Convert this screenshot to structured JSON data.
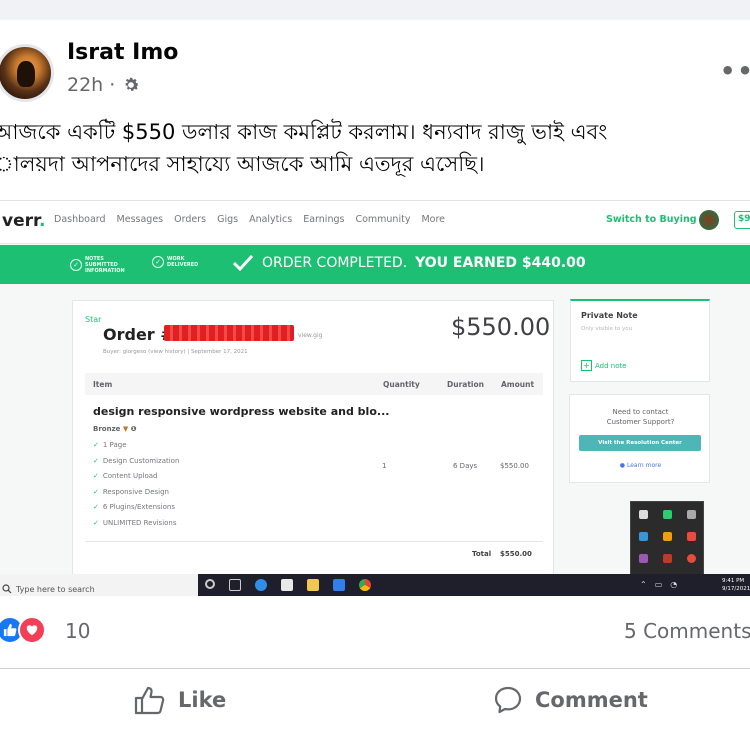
{
  "post": {
    "author": "Israt Imo",
    "time": "22h",
    "privacy_icon": "gear-icon",
    "more_label": "•••",
    "text_line1": "আজকে একটি $550 ডলার কাজ কমপ্লিট করলাম। ধন্যবাদ রাজু ভাই এবং",
    "text_line2": "ালয়দা আপনাদের সাহায্যে আজকে আমি এতদূর এসেছি।"
  },
  "screenshot": {
    "logo": "verr",
    "logo_dot": ".",
    "nav_links": [
      "Dashboard",
      "Messages",
      "Orders",
      "Gigs",
      "Analytics",
      "Earnings",
      "Community",
      "More"
    ],
    "switch_label": "Switch to Buying",
    "balance": "$9",
    "banner": {
      "step1": "NOTES SUBMITTED INFORMATION",
      "step2": "WORK DELIVERED",
      "completed": "ORDER COMPLETED.",
      "earned": "YOU EARNED $440.00"
    },
    "order": {
      "star": "Star",
      "title": "Order #",
      "view": "view.gig",
      "buyer_line": "Buyer: glorgeso (view history) | September 17, 2021",
      "price": "$550.00",
      "headers": {
        "item": "Item",
        "quantity": "Quantity",
        "duration": "Duration",
        "amount": "Amount"
      },
      "item_title": "design responsive wordpress website and blo...",
      "package": "Bronze",
      "features": [
        "1 Page",
        "Design Customization",
        "Content Upload",
        "Responsive Design",
        "6 Plugins/Extensions",
        "UNLIMITED Revisions"
      ],
      "quantity": "1",
      "duration": "6 Days",
      "amount": "$550.00",
      "total_label": "Total",
      "total_value": "$550.00"
    },
    "note": {
      "title": "Private Note",
      "subtitle": "Only visible to you",
      "add_label": "Add note"
    },
    "support": {
      "text1": "Need to contact",
      "text2": "Customer Support?",
      "button": "Visit the Resolution Center",
      "learn": "Learn more"
    },
    "taskbar": {
      "search_placeholder": "Type here to search",
      "time": "9:41 PM",
      "date": "9/17/2021"
    }
  },
  "footer": {
    "reaction_count": "10",
    "comments": "5 Comments",
    "like_label": "Like",
    "comment_label": "Comment"
  },
  "colors": {
    "fiverr_green": "#1dbf73",
    "fb_blue": "#1877f2",
    "love_red": "#f33e58"
  }
}
